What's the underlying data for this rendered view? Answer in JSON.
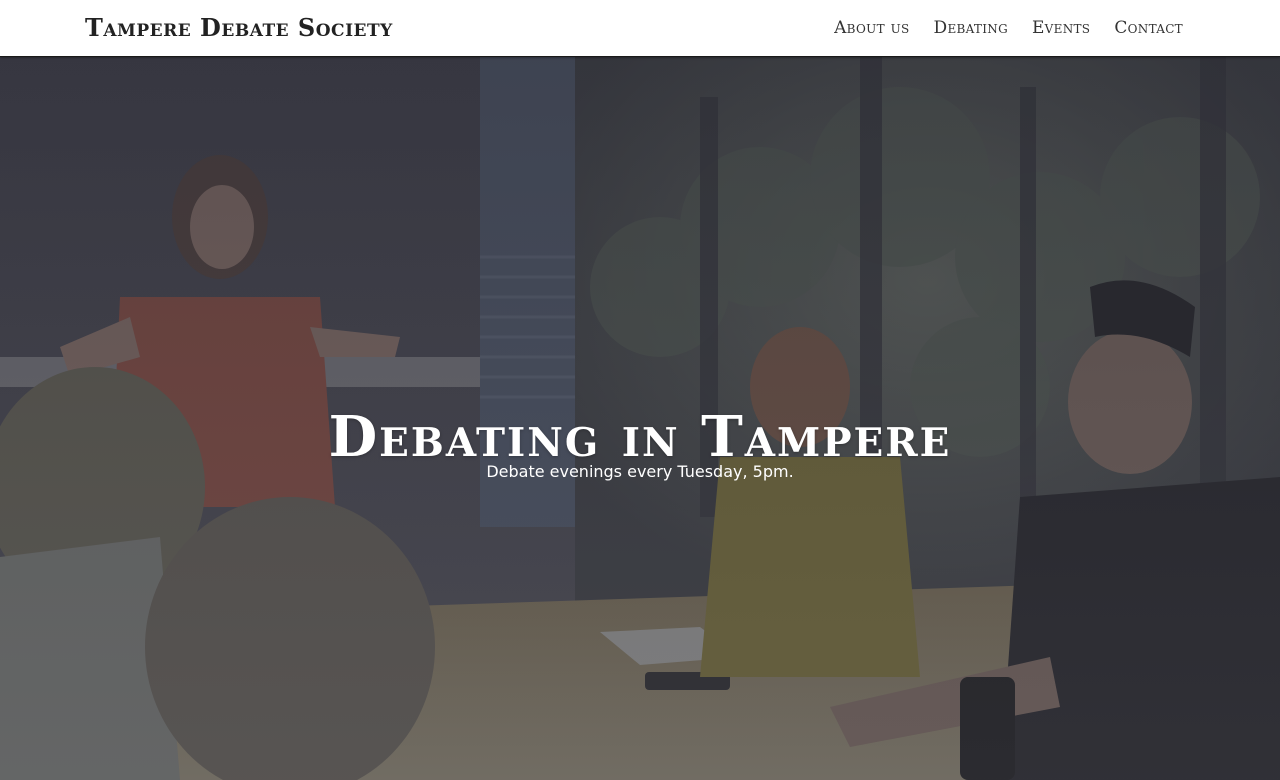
{
  "header": {
    "brand": "Tampere Debate Society",
    "nav": [
      {
        "label": "About us"
      },
      {
        "label": "Debating"
      },
      {
        "label": "Events"
      },
      {
        "label": "Contact"
      }
    ]
  },
  "hero": {
    "title": "Debating in Tampere",
    "subtitle": "Debate evenings every Tuesday, 5pm.",
    "background_image": "debate-room-photo"
  },
  "colors": {
    "header_bg": "#ffffff",
    "header_text": "#222222",
    "hero_overlay": "#3a3a44",
    "hero_text": "#ffffff"
  }
}
